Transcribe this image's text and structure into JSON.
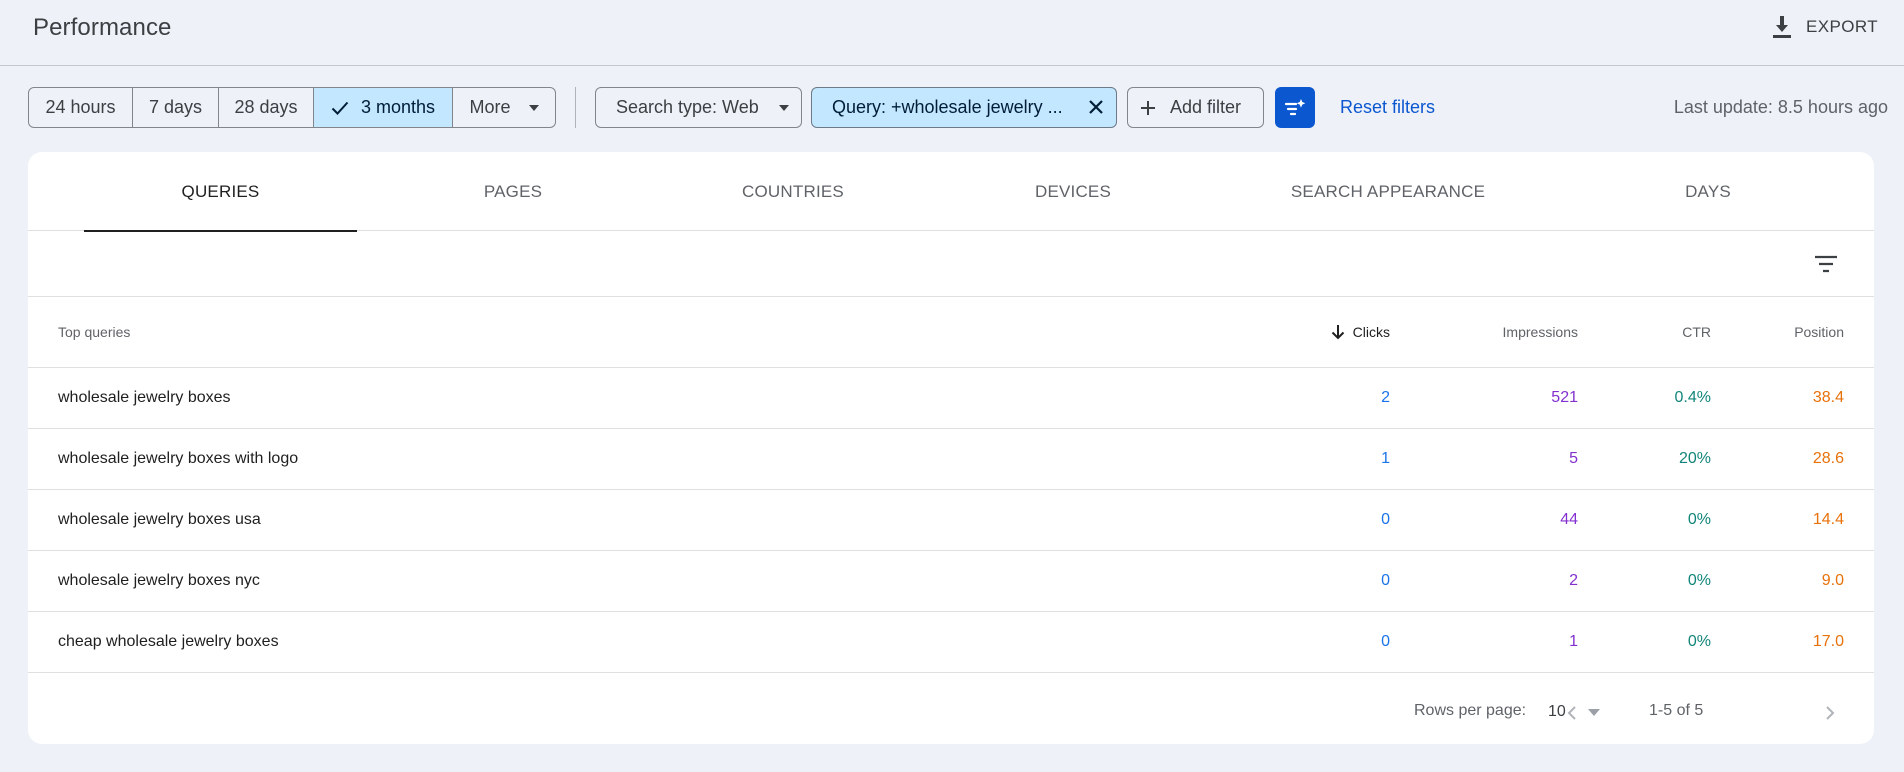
{
  "header": {
    "title": "Performance",
    "export_label": "EXPORT"
  },
  "filters": {
    "date_ranges": [
      {
        "label": "24 hours",
        "active": false
      },
      {
        "label": "7 days",
        "active": false
      },
      {
        "label": "28 days",
        "active": false
      },
      {
        "label": "3 months",
        "active": true
      }
    ],
    "more_label": "More",
    "search_type_label": "Search type: Web",
    "query_filter_label": "Query: +wholesale jewelry ...",
    "add_filter_label": "Add filter",
    "reset_label": "Reset filters",
    "last_update": "Last update: 8.5 hours ago"
  },
  "tabs": [
    {
      "label": "QUERIES",
      "active": true
    },
    {
      "label": "PAGES",
      "active": false
    },
    {
      "label": "COUNTRIES",
      "active": false
    },
    {
      "label": "DEVICES",
      "active": false
    },
    {
      "label": "SEARCH APPEARANCE",
      "active": false
    },
    {
      "label": "DAYS",
      "active": false
    }
  ],
  "table": {
    "columns": {
      "query": "Top queries",
      "clicks": "Clicks",
      "impressions": "Impressions",
      "ctr": "CTR",
      "position": "Position"
    },
    "sorted_by": "clicks",
    "sort_direction": "descending",
    "rows": [
      {
        "query": "wholesale jewelry boxes",
        "clicks": "2",
        "impressions": "521",
        "ctr": "0.4%",
        "position": "38.4"
      },
      {
        "query": "wholesale jewelry boxes with logo",
        "clicks": "1",
        "impressions": "5",
        "ctr": "20%",
        "position": "28.6"
      },
      {
        "query": "wholesale jewelry boxes usa",
        "clicks": "0",
        "impressions": "44",
        "ctr": "0%",
        "position": "14.4"
      },
      {
        "query": "wholesale jewelry boxes nyc",
        "clicks": "0",
        "impressions": "2",
        "ctr": "0%",
        "position": "9.0"
      },
      {
        "query": "cheap wholesale jewelry boxes",
        "clicks": "0",
        "impressions": "1",
        "ctr": "0%",
        "position": "17.0"
      }
    ]
  },
  "pagination": {
    "rows_per_page_label": "Rows per page:",
    "rows_per_page": "10",
    "range": "1-5 of 5"
  },
  "colors": {
    "accent": "#0b57d0",
    "selected_chip": "#c2e7ff",
    "clicks": "#1a73e8",
    "impressions": "#8430ce",
    "ctr": "#12857a",
    "position": "#e8710a"
  },
  "icons": {
    "export": "download-icon",
    "checkmark": "check-icon",
    "dropdown": "caret-down-icon",
    "close": "close-icon",
    "add": "plus-icon",
    "filter_ai": "filter-sparkle-icon",
    "table_filter": "filter-lines-icon",
    "sort": "arrow-down-icon",
    "prev": "chevron-left-icon",
    "next": "chevron-right-icon"
  }
}
